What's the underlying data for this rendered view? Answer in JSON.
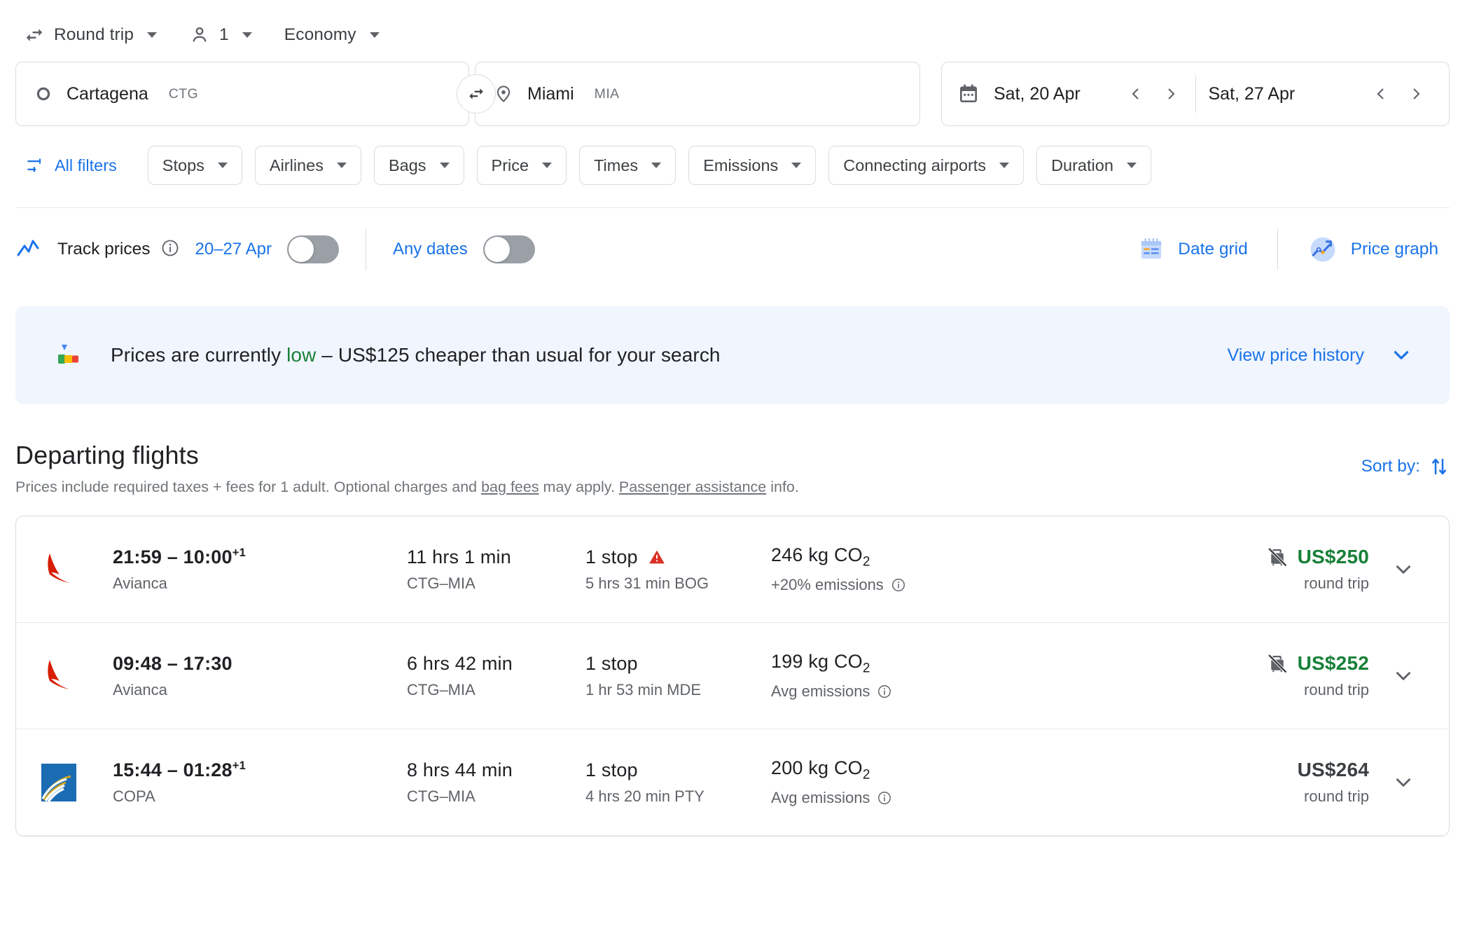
{
  "trip_options": {
    "trip_type": "Round trip",
    "passengers": "1",
    "cabin_class": "Economy"
  },
  "search": {
    "origin_city": "Cartagena",
    "origin_code": "CTG",
    "destination_city": "Miami",
    "destination_code": "MIA",
    "depart_date": "Sat, 20 Apr",
    "return_date": "Sat, 27 Apr"
  },
  "filters": {
    "all_filters_label": "All filters",
    "chips": [
      "Stops",
      "Airlines",
      "Bags",
      "Price",
      "Times",
      "Emissions",
      "Connecting airports",
      "Duration"
    ]
  },
  "track": {
    "title": "Track prices",
    "date_range": "20–27 Apr",
    "any_dates": "Any dates",
    "date_grid": "Date grid",
    "price_graph": "Price graph",
    "toggle_dates_on": false,
    "toggle_anydates_on": false
  },
  "banner": {
    "prefix": "Prices are currently ",
    "status": "low",
    "suffix": " – US$125 cheaper than usual for your search",
    "link": "View price history",
    "accent_low": "#188038",
    "background": "#f0f5fe"
  },
  "section": {
    "title": "Departing flights",
    "subtitle_part1": "Prices include required taxes + fees for 1 adult. Optional charges and ",
    "subtitle_link1": "bag fees",
    "subtitle_part2": " may apply. ",
    "subtitle_link2": "Passenger assistance",
    "subtitle_part3": " info.",
    "sort_by": "Sort by:"
  },
  "flights": [
    {
      "airline": "Avianca",
      "logo": "avianca-logo",
      "times": "21:59 – 10:00",
      "next_day": "+1",
      "duration": "11 hrs 1 min",
      "route": "CTG–MIA",
      "stops": "1 stop",
      "warning": true,
      "layover": "5 hrs 31 min BOG",
      "emissions": "246 kg CO",
      "emissions_sub": "+20% emissions",
      "price": "US$250",
      "price_color": "green",
      "fare_type": "round trip",
      "no_bag_icon": true
    },
    {
      "airline": "Avianca",
      "logo": "avianca-logo",
      "times": "09:48 – 17:30",
      "next_day": "",
      "duration": "6 hrs 42 min",
      "route": "CTG–MIA",
      "stops": "1 stop",
      "warning": false,
      "layover": "1 hr 53 min MDE",
      "emissions": "199 kg CO",
      "emissions_sub": "Avg emissions",
      "price": "US$252",
      "price_color": "green",
      "fare_type": "round trip",
      "no_bag_icon": true
    },
    {
      "airline": "COPA",
      "logo": "copa-logo",
      "times": "15:44 – 01:28",
      "next_day": "+1",
      "duration": "8 hrs 44 min",
      "route": "CTG–MIA",
      "stops": "1 stop",
      "warning": false,
      "layover": "4 hrs 20 min PTY",
      "emissions": "200 kg CO",
      "emissions_sub": "Avg emissions",
      "price": "US$264",
      "price_color": "gray",
      "fare_type": "round trip",
      "no_bag_icon": false
    }
  ]
}
